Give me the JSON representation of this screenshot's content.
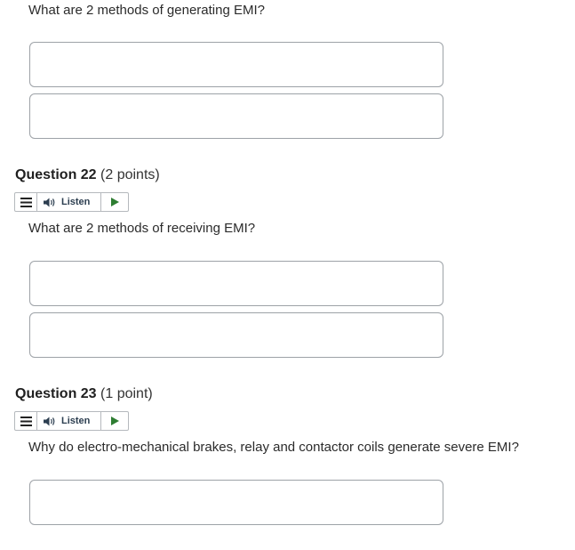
{
  "q21": {
    "prompt": "What are 2 methods of generating EMI?",
    "answer1_value": "",
    "answer2_value": ""
  },
  "q22": {
    "number": "Question 22",
    "points": "(2 points)",
    "listen_label": "Listen",
    "prompt": "What are 2 methods of receiving EMI?",
    "answer1_value": "",
    "answer2_value": ""
  },
  "q23": {
    "number": "Question 23",
    "points": "(1 point)",
    "listen_label": "Listen",
    "prompt": "Why do electro-mechanical brakes, relay and contactor coils generate severe EMI?",
    "answer1_value": ""
  },
  "colors": {
    "play_green": "#2e7d32",
    "border": "#9da2a7"
  },
  "icons": {
    "menu": "menu-icon",
    "speaker": "speaker-icon",
    "play": "play-icon"
  }
}
